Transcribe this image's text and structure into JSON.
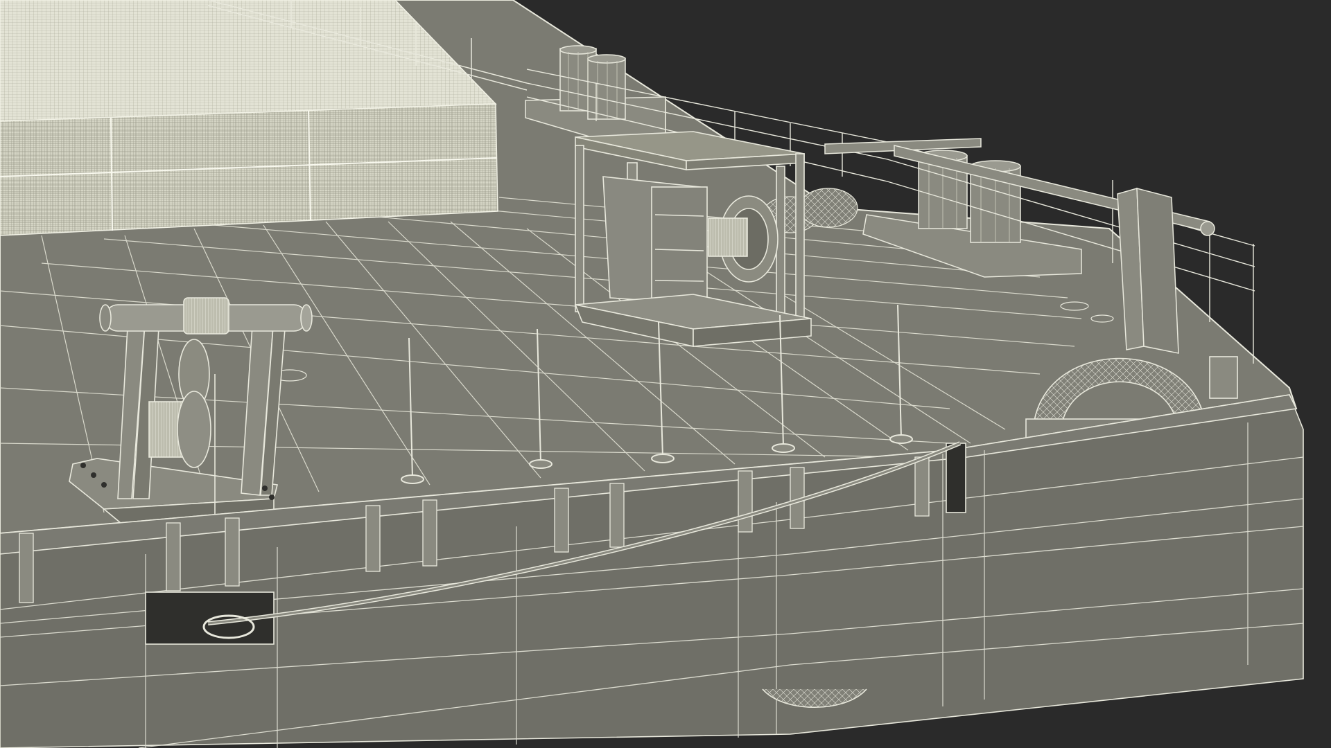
{
  "scene": {
    "subject": "deck-barge-bow-wireframe",
    "background_color": "#2a2a2a",
    "deck_color": "#7b7b72",
    "hull_color": "#6f6f67",
    "wire_color": "#e8e8dc",
    "cargo_color": "#cfcfbf"
  }
}
